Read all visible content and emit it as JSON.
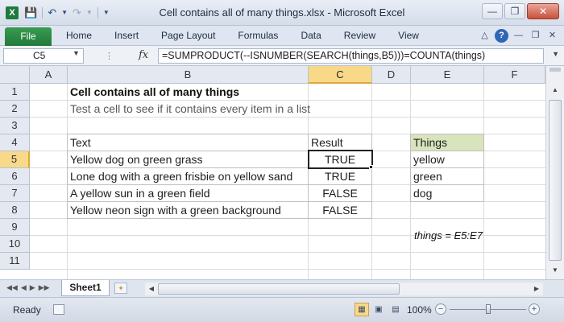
{
  "window": {
    "title": "Cell contains all of many things.xlsx - Microsoft Excel",
    "app_icon": "X"
  },
  "ribbon": {
    "file_label": "File",
    "tabs": [
      "Home",
      "Insert",
      "Page Layout",
      "Formulas",
      "Data",
      "Review",
      "View"
    ]
  },
  "formula_bar": {
    "name_box": "C5",
    "fx_label": "fx",
    "formula": "=SUMPRODUCT(--ISNUMBER(SEARCH(things,B5)))=COUNTA(things)"
  },
  "grid": {
    "columns": [
      "A",
      "B",
      "C",
      "D",
      "E",
      "F"
    ],
    "selected_column": "C",
    "rows": [
      "1",
      "2",
      "3",
      "4",
      "5",
      "6",
      "7",
      "8",
      "9",
      "10",
      "11"
    ],
    "selected_row": "5",
    "title": "Cell contains all of many things",
    "subtitle": "Test a cell to see if it contains every item in a list",
    "table": {
      "headers": [
        "Text",
        "Result"
      ],
      "rows": [
        [
          "Yellow dog on green grass",
          "TRUE"
        ],
        [
          "Lone dog with a green frisbie on yellow sand",
          "TRUE"
        ],
        [
          "A yellow sun in a green field",
          "FALSE"
        ],
        [
          "Yellow neon sign with a green background",
          "FALSE"
        ]
      ]
    },
    "things": {
      "header": "Things",
      "items": [
        "yellow",
        "green",
        "dog"
      ]
    },
    "named_range_note": "things = E5:E7"
  },
  "sheet_tabs": {
    "active": "Sheet1"
  },
  "status_bar": {
    "ready": "Ready",
    "zoom": "100%",
    "zoom_level_percent": 100
  },
  "colors": {
    "selected_header": "#f8d98a",
    "things_header_fill": "#d8e4bc",
    "file_tab": "#217a3a"
  }
}
